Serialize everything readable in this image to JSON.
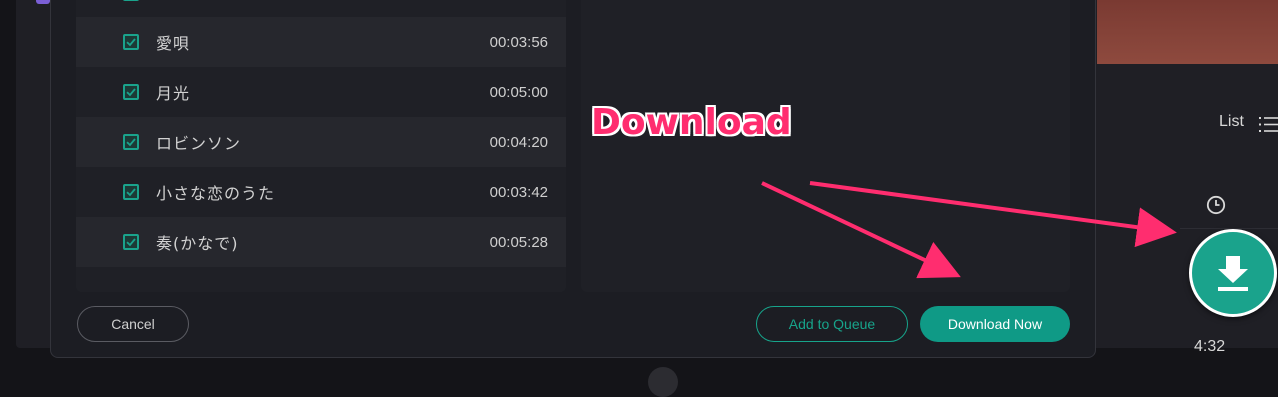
{
  "background_app": {
    "view_label": "List",
    "partial_time": "4:32"
  },
  "dialog": {
    "tracks": [
      {
        "title": "愛唄",
        "duration": "00:03:56",
        "checked": true
      },
      {
        "title": "月光",
        "duration": "00:05:00",
        "checked": true
      },
      {
        "title": "ロビンソン",
        "duration": "00:04:20",
        "checked": true
      },
      {
        "title": "小さな恋のうた",
        "duration": "00:03:42",
        "checked": true
      },
      {
        "title": "奏(かなで)",
        "duration": "00:05:28",
        "checked": true
      }
    ],
    "buttons": {
      "cancel": "Cancel",
      "add_to_queue": "Add to Queue",
      "download_now": "Download Now"
    }
  },
  "annotation": {
    "label": "Download",
    "color": "#ff2d6f"
  },
  "colors": {
    "accent": "#0f9a86",
    "checkbox": "#1aa38c",
    "background_band": "#7a3a32"
  },
  "icons": [
    "list-icon",
    "clock-icon",
    "checkbox-checked-icon",
    "download-icon"
  ]
}
